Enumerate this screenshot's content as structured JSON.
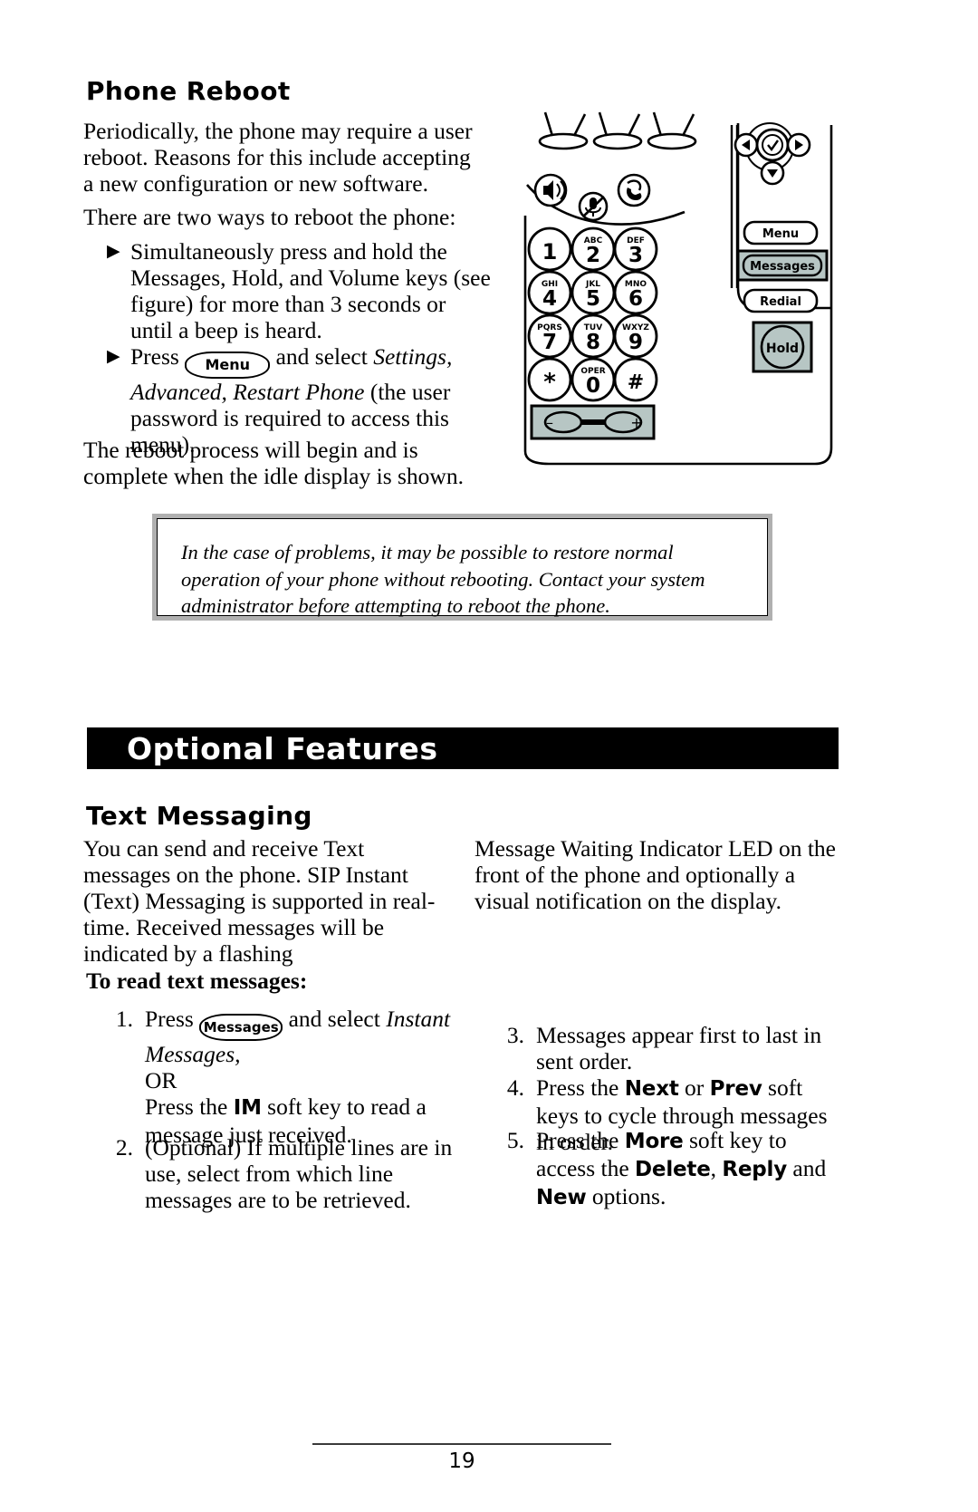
{
  "page": {
    "number": "19"
  },
  "reboot": {
    "heading": "Phone Reboot",
    "para1": "Periodically, the phone may require a user reboot.  Reasons for this include accepting a new configuration or new software.",
    "para2": "There are two ways to reboot the phone:",
    "bullet1_mark": "▶",
    "bullet1": "Simultaneously press and hold the Messages, Hold, and Volume keys (see figure) for more than 3 seconds or until a beep is heard.",
    "bullet2_mark": "▶",
    "bullet2_pre": "Press",
    "bullet2_key": "Menu",
    "bullet2_mid": "and select",
    "bullet2_italic": "Settings, Advanced, Restart Phone",
    "bullet2_post": "(the user password is required to access this menu).",
    "para3": "The reboot process will begin and is complete when the idle display is shown."
  },
  "note": {
    "text": "In the case of problems, it may be possible to restore normal operation of your phone without rebooting.  Contact your system administrator before attempting to reboot the phone."
  },
  "optional_features": {
    "banner": "Optional Features"
  },
  "text_messaging": {
    "heading": "Text Messaging",
    "intro_left": "You can send and receive Text messages on the phone.  SIP Instant (Text) Messaging is supported in real-time.  Received messages will be indicated by a flashing",
    "intro_right": "Message Waiting Indicator LED on the front of the phone and optionally a visual notification on the display.",
    "subheading": "To read text messages:",
    "steps": [
      {
        "num": "1.",
        "pre": "Press",
        "key": "Messages",
        "mid": "and select",
        "italic": "Instant Messages,",
        "or": "OR",
        "post_pre": "Press the",
        "post_key": "IM",
        "post_rest": "soft key to read a message just received."
      },
      {
        "num": "2.",
        "text": "(Optional)  If multiple lines are in use, select from which line messages are to be retrieved."
      },
      {
        "num": "3.",
        "text": "Messages appear first to last in sent order."
      },
      {
        "num": "4.",
        "pre": "Press the",
        "key1": "Next",
        "conj": "or",
        "key2": "Prev",
        "post": "soft keys to cycle through messages in order."
      },
      {
        "num": "5.",
        "pre": "Press the",
        "key1": "More",
        "post": "soft key to access the",
        "opt1": "Delete",
        "sep1": ",",
        "opt2": "Reply",
        "conj": "and",
        "opt3": "New",
        "tail": "options."
      }
    ]
  },
  "phone_figure": {
    "line_keys": [
      "line-key-1",
      "line-key-2",
      "line-key-3"
    ],
    "feature_icons": [
      "speaker-icon",
      "mute-icon",
      "headset-icon"
    ],
    "keypad": [
      {
        "digit": "1",
        "letters": ""
      },
      {
        "digit": "2",
        "letters": "ABC"
      },
      {
        "digit": "3",
        "letters": "DEF"
      },
      {
        "digit": "4",
        "letters": "GHI"
      },
      {
        "digit": "5",
        "letters": "JKL"
      },
      {
        "digit": "6",
        "letters": "MNO"
      },
      {
        "digit": "7",
        "letters": "PQRS"
      },
      {
        "digit": "8",
        "letters": "TUV"
      },
      {
        "digit": "9",
        "letters": "WXYZ"
      },
      {
        "digit": "*",
        "letters": ""
      },
      {
        "digit": "0",
        "letters": "OPER"
      },
      {
        "digit": "#",
        "letters": ""
      }
    ],
    "side_keys": [
      {
        "label": "Menu",
        "highlight": false
      },
      {
        "label": "Messages",
        "highlight": true
      },
      {
        "label": "Redial",
        "highlight": false
      },
      {
        "label": "Hold",
        "highlight": true
      }
    ],
    "volume_minus": "–",
    "volume_plus": "+",
    "highlight_color": "#b7c6c4"
  }
}
